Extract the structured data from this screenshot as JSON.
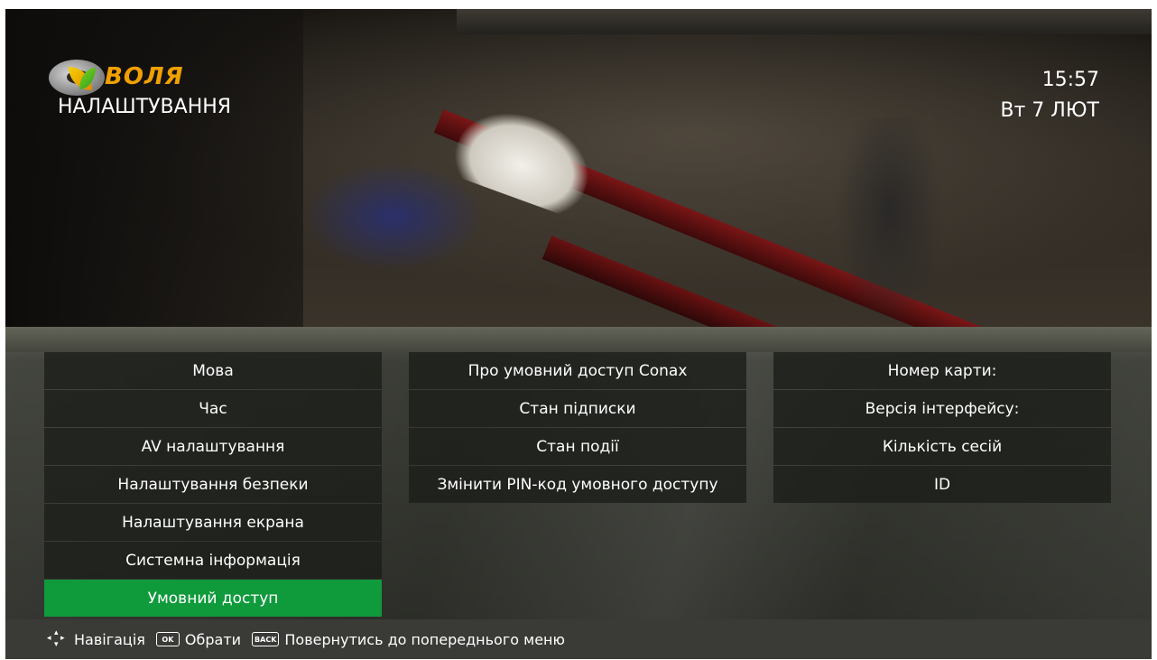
{
  "header": {
    "brand": "ВОЛЯ",
    "title": "НАЛАШТУВАННЯ",
    "time": "15:57",
    "date": "Вт 7 ЛЮТ"
  },
  "menu": {
    "main": [
      {
        "label": "Мова"
      },
      {
        "label": "Час"
      },
      {
        "label": "AV налаштування"
      },
      {
        "label": "Налаштування безпеки"
      },
      {
        "label": "Налаштування екрана"
      },
      {
        "label": "Системна інформація"
      },
      {
        "label": "Умовний доступ",
        "selected": true
      }
    ],
    "sub": [
      {
        "label": "Про умовний доступ Conax"
      },
      {
        "label": "Стан підписки"
      },
      {
        "label": "Стан події"
      },
      {
        "label": "Змінити PIN-код умовного доступу"
      }
    ],
    "info": [
      {
        "label": "Номер карти:"
      },
      {
        "label": "Версія інтерфейсу:"
      },
      {
        "label": "Кількість сесій"
      },
      {
        "label": "ID"
      }
    ]
  },
  "footer": {
    "navigate_label": "Навігація",
    "ok_key": "OK",
    "ok_label": "Обрати",
    "back_key": "BACK",
    "back_label": "Повернутись до попереднього меню"
  },
  "colors": {
    "selected": "#0f9a3c",
    "brand": "#f0a000",
    "item_bg": "#1c1e1a"
  },
  "icons": [
    "navigation-arrows-icon",
    "ok-key-icon",
    "back-key-icon",
    "voliya-logo"
  ]
}
